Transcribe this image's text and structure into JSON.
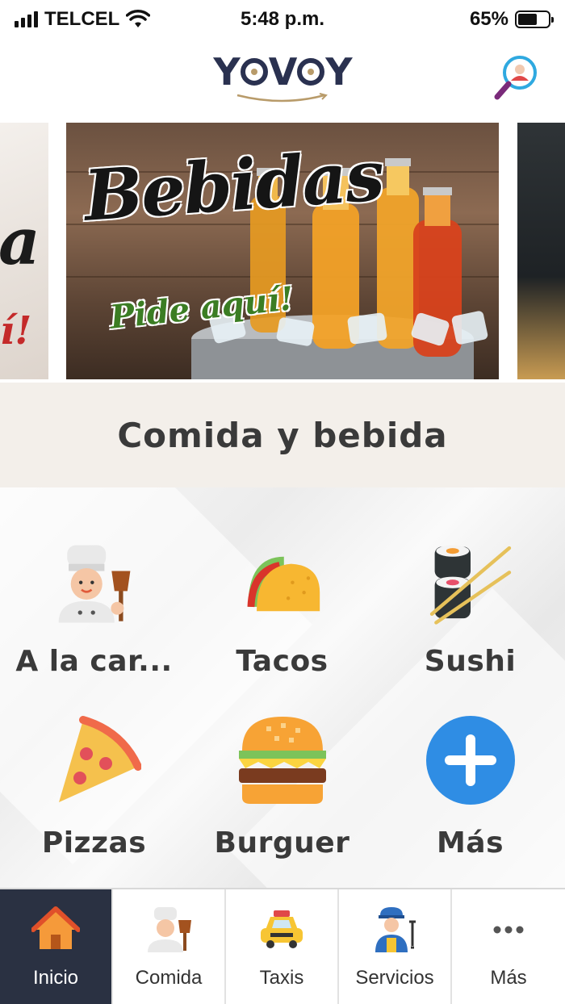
{
  "status_bar": {
    "carrier": "TELCEL",
    "time": "5:48 p.m.",
    "battery_percent": "65%",
    "battery_level": 0.65
  },
  "header": {
    "logo_text": [
      "Y",
      "V",
      "Y"
    ],
    "brand": "YOVOY",
    "profile_icon": "profile-search-icon"
  },
  "carousel": {
    "current_slide": {
      "title": "Bebidas",
      "subtitle": "Pide aquí!"
    },
    "prev_slide": {
      "text_fragment": "a",
      "text_fragment2": "í!"
    }
  },
  "category": {
    "title": "Comida y bebida"
  },
  "grid": {
    "items": [
      {
        "label": "A la car...",
        "icon": "chef-icon"
      },
      {
        "label": "Tacos",
        "icon": "taco-icon"
      },
      {
        "label": "Sushi",
        "icon": "sushi-icon"
      },
      {
        "label": "Pizzas",
        "icon": "pizza-icon"
      },
      {
        "label": "Burguer",
        "icon": "burger-icon"
      },
      {
        "label": "Más",
        "icon": "plus-icon"
      }
    ]
  },
  "tabbar": {
    "active": "Inicio",
    "tabs": [
      {
        "label": "Inicio",
        "icon": "home-icon"
      },
      {
        "label": "Comida",
        "icon": "chef-icon"
      },
      {
        "label": "Taxis",
        "icon": "taxi-icon"
      },
      {
        "label": "Servicios",
        "icon": "mechanic-icon"
      },
      {
        "label": "Más",
        "icon": "more-icon"
      }
    ]
  },
  "colors": {
    "brand_navy": "#2a3150",
    "brand_gold": "#b89b6a",
    "active_tab_bg": "#2a3142",
    "plus_blue": "#2f8de4"
  }
}
